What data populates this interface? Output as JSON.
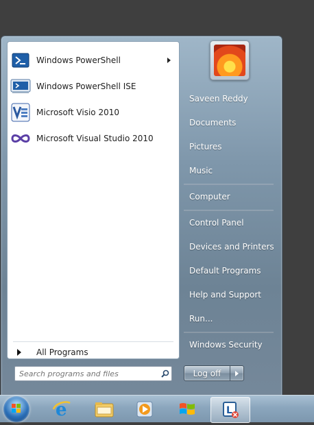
{
  "programs": [
    {
      "label": "Windows PowerShell",
      "has_submenu": true,
      "icon": "powershell-icon"
    },
    {
      "label": "Windows PowerShell ISE",
      "has_submenu": false,
      "icon": "powershell-ise-icon"
    },
    {
      "label": "Microsoft Visio 2010",
      "has_submenu": false,
      "icon": "visio-icon"
    },
    {
      "label": "Microsoft Visual Studio 2010",
      "has_submenu": false,
      "icon": "visual-studio-icon"
    }
  ],
  "all_programs_label": "All Programs",
  "search": {
    "placeholder": "Search programs and files"
  },
  "user": {
    "name": "Saveen Reddy"
  },
  "right_items": [
    {
      "label": "Saveen Reddy"
    },
    {
      "label": "Documents"
    },
    {
      "label": "Pictures"
    },
    {
      "label": "Music"
    },
    {
      "label": "Computer"
    },
    {
      "label": "Control Panel"
    },
    {
      "label": "Devices and Printers"
    },
    {
      "label": "Default Programs"
    },
    {
      "label": "Help and Support"
    },
    {
      "label": "Run..."
    },
    {
      "label": "Windows Security"
    }
  ],
  "logoff_label": "Log off",
  "taskbar": {
    "items": [
      {
        "icon": "internet-explorer-icon"
      },
      {
        "icon": "windows-explorer-icon"
      },
      {
        "icon": "media-player-icon"
      },
      {
        "icon": "windows-flag-icon"
      },
      {
        "icon": "remote-desktop-icon"
      }
    ]
  },
  "colors": {
    "accent": "#2b72c6",
    "menu_bg": "#7f97ab"
  }
}
